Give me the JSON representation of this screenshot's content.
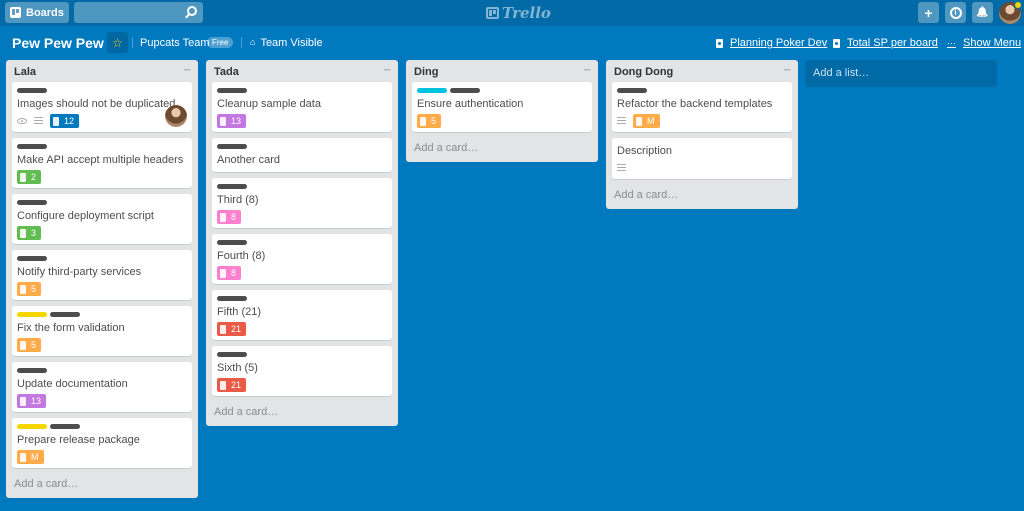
{
  "topbar": {
    "boards_label": "Boards",
    "search_placeholder": "",
    "logo_text": "Trello",
    "add_label": "+",
    "info_label": "i",
    "notifications_label": "🔔"
  },
  "board": {
    "title": "Pew Pew Pew",
    "team": "Pupcats Team",
    "team_badge": "Free",
    "visibility": "Team Visible",
    "powerups": [
      "Planning Poker Dev",
      "Total SP per board"
    ],
    "more_dots": "···",
    "show_menu": "Show Menu"
  },
  "colors": {
    "background": "#0079bf",
    "label_dark": "#4d4d4d",
    "label_yellow": "#f2d600",
    "label_sky": "#00c2e0",
    "sp_blue": "#0079bf",
    "sp_green": "#61bd4f",
    "sp_orange": "#ffab4a",
    "sp_purple": "#c377e0",
    "sp_pink": "#ff80ce",
    "sp_red": "#eb5a46"
  },
  "lists": [
    {
      "name": "Lala",
      "add_card": "Add a card…",
      "cards": [
        {
          "title": "Images should not be duplicated",
          "labels": [
            "dark"
          ],
          "watch": true,
          "desc": true,
          "sp": "12",
          "sp_color": "blue",
          "avatar": true
        },
        {
          "title": "Make API accept multiple headers",
          "labels": [
            "dark"
          ],
          "sp": "2",
          "sp_color": "green"
        },
        {
          "title": "Configure deployment script",
          "labels": [
            "dark"
          ],
          "sp": "3",
          "sp_color": "green"
        },
        {
          "title": "Notify third-party services",
          "labels": [
            "dark"
          ],
          "sp": "5",
          "sp_color": "orange"
        },
        {
          "title": "Fix the form validation",
          "labels": [
            "yellow",
            "dark"
          ],
          "sp": "5",
          "sp_color": "orange"
        },
        {
          "title": "Update documentation",
          "labels": [
            "dark"
          ],
          "sp": "13",
          "sp_color": "purple"
        },
        {
          "title": "Prepare release package",
          "labels": [
            "yellow",
            "dark"
          ],
          "sp": "M",
          "sp_color": "orange"
        }
      ]
    },
    {
      "name": "Tada",
      "add_card": "Add a card…",
      "cards": [
        {
          "title": "Cleanup sample data",
          "labels": [
            "dark"
          ],
          "sp": "13",
          "sp_color": "purple"
        },
        {
          "title": "Another card",
          "labels": [
            "dark"
          ]
        },
        {
          "title": "Third (8)",
          "labels": [
            "dark"
          ],
          "sp": "8",
          "sp_color": "pink"
        },
        {
          "title": "Fourth (8)",
          "labels": [
            "dark"
          ],
          "sp": "8",
          "sp_color": "pink"
        },
        {
          "title": "Fifth (21)",
          "labels": [
            "dark"
          ],
          "sp": "21",
          "sp_color": "red"
        },
        {
          "title": "Sixth (5)",
          "labels": [
            "dark"
          ],
          "sp": "21",
          "sp_color": "red"
        }
      ]
    },
    {
      "name": "Ding",
      "add_card": "Add a card…",
      "cards": [
        {
          "title": "Ensure authentication",
          "labels": [
            "sky",
            "dark"
          ],
          "sp": "5",
          "sp_color": "orange"
        }
      ]
    },
    {
      "name": "Dong Dong",
      "add_card": "Add a card…",
      "cards": [
        {
          "title": "Refactor the backend templates",
          "labels": [
            "dark"
          ],
          "desc": true,
          "sp": "M",
          "sp_color": "orange"
        },
        {
          "title": "Description",
          "labels": [],
          "desc": true
        }
      ]
    }
  ],
  "add_list": "Add a list…"
}
